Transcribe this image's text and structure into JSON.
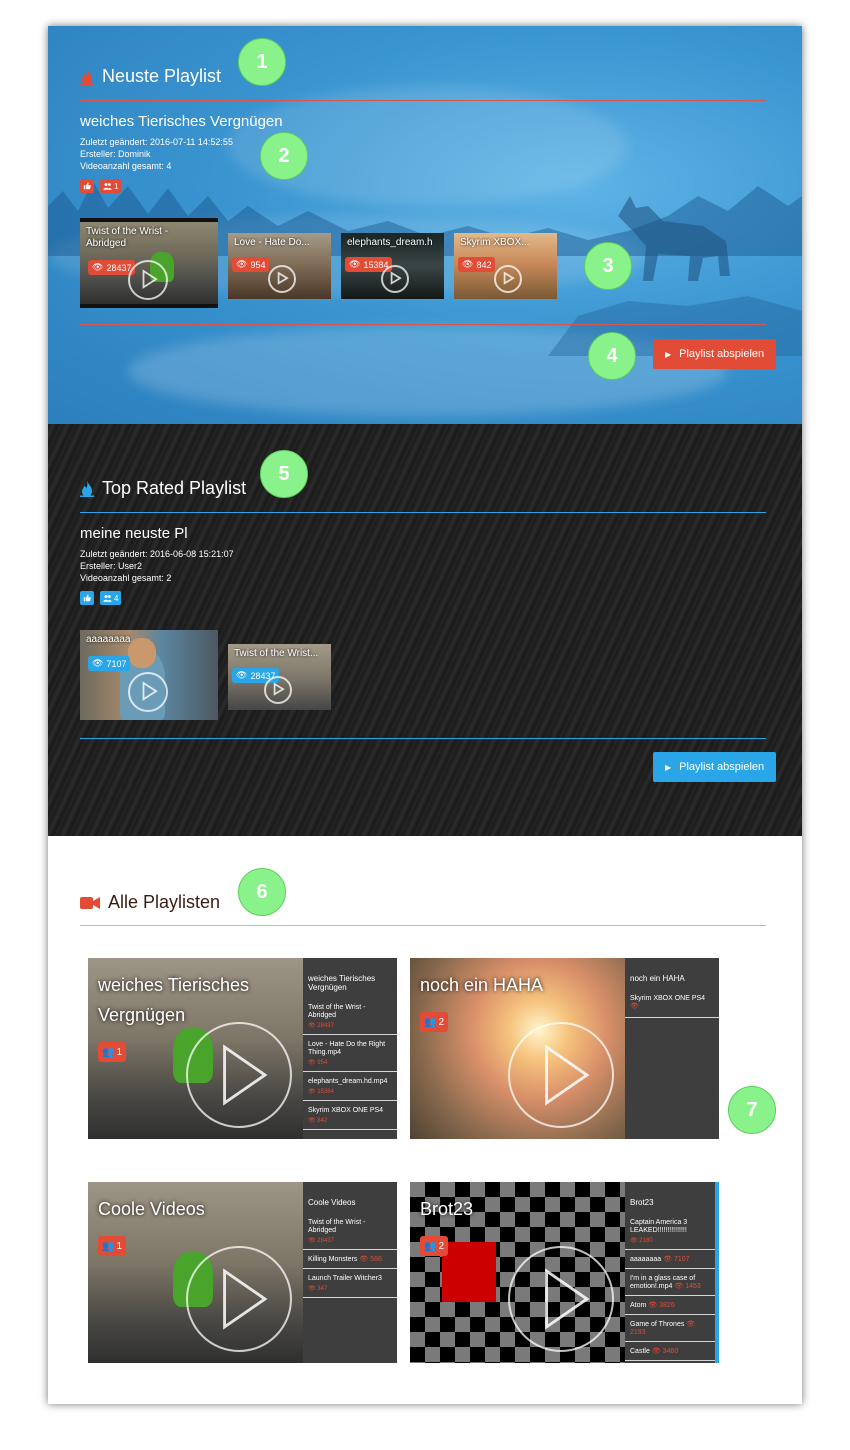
{
  "colors": {
    "accent_red": "#e24b35",
    "accent_blue": "#2aa6e8",
    "marker_green": "#8af28a"
  },
  "markers": [
    "1",
    "2",
    "3",
    "4",
    "5",
    "6",
    "7"
  ],
  "neuste": {
    "section_title": "Neuste Playlist",
    "playlist_name": "weiches Tierisches Vergnügen",
    "changed": "Zuletzt geändert: 2016-07-11 14:52:55",
    "creator": "Ersteller: Dominik",
    "count": "Videoanzahl gesamt: 4",
    "likes_badge": "",
    "users_badge": "1",
    "videos": [
      {
        "title": "Twist of the Wrist - Abridged",
        "views": "28437"
      },
      {
        "title": "Love - Hate Do...",
        "views": "954"
      },
      {
        "title": "elephants_dream.h",
        "views": "15384"
      },
      {
        "title": "Skyrim XBOX...",
        "views": "842"
      }
    ],
    "play_button": "Playlist abspielen"
  },
  "top": {
    "section_title": "Top Rated Playlist",
    "playlist_name": "meine neuste Pl",
    "changed": "Zuletzt geändert: 2016-06-08 15:21:07",
    "creator": "Ersteller: User2",
    "count": "Videoanzahl gesamt: 2",
    "users_badge": "4",
    "videos": [
      {
        "title": "aaaaaaaa",
        "views": "7107"
      },
      {
        "title": "Twist of the Wrist...",
        "views": "28437"
      }
    ],
    "play_button": "Playlist abspielen"
  },
  "all": {
    "section_title": "Alle Playlisten",
    "cards": [
      {
        "hero_title": "weiches Tierisches Vergnügen",
        "badge": "1",
        "side_title": "weiches Tierisches Vergnügen",
        "items": [
          {
            "name": "Twist of the Wrist - Abridged",
            "views": "28437"
          },
          {
            "name": "Love - Hate Do the Right Thing.mp4",
            "views": "954"
          },
          {
            "name": "elephants_dream.hd.mp4",
            "views": "15384"
          },
          {
            "name": "Skyrim XBOX ONE PS4",
            "views": "842"
          }
        ]
      },
      {
        "hero_title": "noch ein HAHA",
        "badge": "2",
        "side_title": "noch ein HAHA",
        "items": [
          {
            "name": "Skyrim XBOX ONE PS4",
            "views": ""
          }
        ]
      },
      {
        "hero_title": "Coole Videos",
        "badge": "1",
        "side_title": "Coole Videos",
        "items": [
          {
            "name": "Twist of the Wrist - Abridged",
            "views": "28437"
          },
          {
            "name": "Killing Monsters",
            "views": "586"
          },
          {
            "name": "Launch Trailer Witcher3",
            "views": "347"
          }
        ]
      },
      {
        "hero_title": "Brot23",
        "badge": "2",
        "side_title": "Brot23",
        "items": [
          {
            "name": "Captain America 3 LEAKED!!!!!!!!!!!!!!!",
            "views": "2180"
          },
          {
            "name": "aaaaaaaa",
            "views": "7107"
          },
          {
            "name": "I'm in a glass case of emotion!.mp4",
            "views": "1453"
          },
          {
            "name": "Atom",
            "views": "3826"
          },
          {
            "name": "Game of Thrones",
            "views": "2193"
          },
          {
            "name": "Castle",
            "views": "3460"
          }
        ]
      }
    ]
  }
}
